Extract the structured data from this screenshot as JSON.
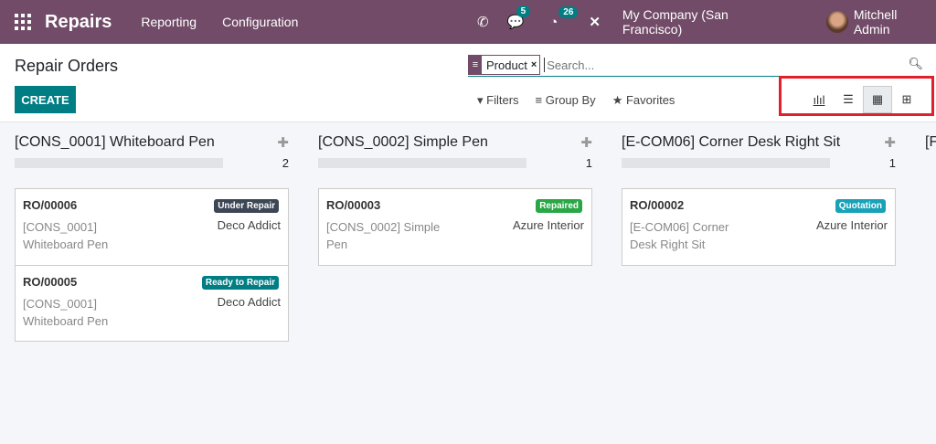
{
  "navbar": {
    "app": "Repairs",
    "menus": [
      "Reporting",
      "Configuration"
    ],
    "messages_count": "5",
    "activities_count": "26",
    "company": "My Company (San Francisco)",
    "user": "Mitchell Admin",
    "color": "#714B67"
  },
  "control": {
    "title": "Repair Orders",
    "create": "CREATE",
    "facet": "Product",
    "search_placeholder": "Search...",
    "filters": "Filters",
    "group_by": "Group By",
    "favorites": "Favorites",
    "views": [
      "graph",
      "list",
      "kanban",
      "pivot"
    ],
    "active_view": "kanban"
  },
  "columns": [
    {
      "title": "[CONS_0001] Whiteboard Pen",
      "count": "2",
      "cards": [
        {
          "ref": "RO/00006",
          "status": "Under Repair",
          "status_color": "#3c4654",
          "product": "[CONS_0001] Whiteboard Pen",
          "customer": "Deco Addict"
        },
        {
          "ref": "RO/00005",
          "status": "Ready to Repair",
          "status_color": "#017e84",
          "product": "[CONS_0001] Whiteboard Pen",
          "customer": "Deco Addict"
        }
      ]
    },
    {
      "title": "[CONS_0002] Simple Pen",
      "count": "1",
      "cards": [
        {
          "ref": "RO/00003",
          "status": "Repaired",
          "status_color": "#28a745",
          "product": "[CONS_0002] Simple Pen",
          "customer": "Azure Interior"
        }
      ]
    },
    {
      "title": "[E-COM06] Corner Desk Right Sit",
      "count": "1",
      "cards": [
        {
          "ref": "RO/00002",
          "status": "Quotation",
          "status_color": "#17a2b8",
          "product": "[E-COM06] Corner Desk Right Sit",
          "customer": "Azure Interior"
        }
      ]
    },
    {
      "title": "[F"
    }
  ]
}
